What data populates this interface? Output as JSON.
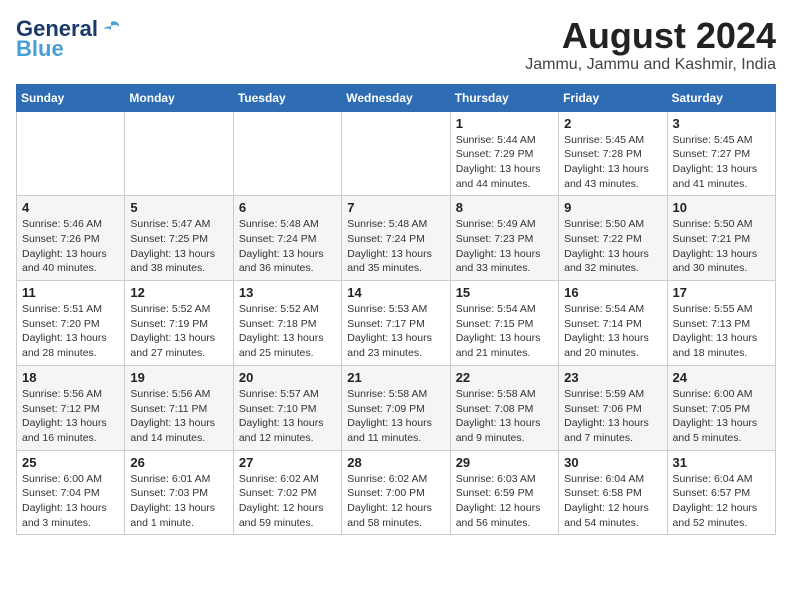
{
  "header": {
    "logo_line1": "General",
    "logo_line2": "Blue",
    "month_title": "August 2024",
    "location": "Jammu, Jammu and Kashmir, India"
  },
  "columns": [
    "Sunday",
    "Monday",
    "Tuesday",
    "Wednesday",
    "Thursday",
    "Friday",
    "Saturday"
  ],
  "weeks": [
    [
      {
        "day": "",
        "info": ""
      },
      {
        "day": "",
        "info": ""
      },
      {
        "day": "",
        "info": ""
      },
      {
        "day": "",
        "info": ""
      },
      {
        "day": "1",
        "info": "Sunrise: 5:44 AM\nSunset: 7:29 PM\nDaylight: 13 hours\nand 44 minutes."
      },
      {
        "day": "2",
        "info": "Sunrise: 5:45 AM\nSunset: 7:28 PM\nDaylight: 13 hours\nand 43 minutes."
      },
      {
        "day": "3",
        "info": "Sunrise: 5:45 AM\nSunset: 7:27 PM\nDaylight: 13 hours\nand 41 minutes."
      }
    ],
    [
      {
        "day": "4",
        "info": "Sunrise: 5:46 AM\nSunset: 7:26 PM\nDaylight: 13 hours\nand 40 minutes."
      },
      {
        "day": "5",
        "info": "Sunrise: 5:47 AM\nSunset: 7:25 PM\nDaylight: 13 hours\nand 38 minutes."
      },
      {
        "day": "6",
        "info": "Sunrise: 5:48 AM\nSunset: 7:24 PM\nDaylight: 13 hours\nand 36 minutes."
      },
      {
        "day": "7",
        "info": "Sunrise: 5:48 AM\nSunset: 7:24 PM\nDaylight: 13 hours\nand 35 minutes."
      },
      {
        "day": "8",
        "info": "Sunrise: 5:49 AM\nSunset: 7:23 PM\nDaylight: 13 hours\nand 33 minutes."
      },
      {
        "day": "9",
        "info": "Sunrise: 5:50 AM\nSunset: 7:22 PM\nDaylight: 13 hours\nand 32 minutes."
      },
      {
        "day": "10",
        "info": "Sunrise: 5:50 AM\nSunset: 7:21 PM\nDaylight: 13 hours\nand 30 minutes."
      }
    ],
    [
      {
        "day": "11",
        "info": "Sunrise: 5:51 AM\nSunset: 7:20 PM\nDaylight: 13 hours\nand 28 minutes."
      },
      {
        "day": "12",
        "info": "Sunrise: 5:52 AM\nSunset: 7:19 PM\nDaylight: 13 hours\nand 27 minutes."
      },
      {
        "day": "13",
        "info": "Sunrise: 5:52 AM\nSunset: 7:18 PM\nDaylight: 13 hours\nand 25 minutes."
      },
      {
        "day": "14",
        "info": "Sunrise: 5:53 AM\nSunset: 7:17 PM\nDaylight: 13 hours\nand 23 minutes."
      },
      {
        "day": "15",
        "info": "Sunrise: 5:54 AM\nSunset: 7:15 PM\nDaylight: 13 hours\nand 21 minutes."
      },
      {
        "day": "16",
        "info": "Sunrise: 5:54 AM\nSunset: 7:14 PM\nDaylight: 13 hours\nand 20 minutes."
      },
      {
        "day": "17",
        "info": "Sunrise: 5:55 AM\nSunset: 7:13 PM\nDaylight: 13 hours\nand 18 minutes."
      }
    ],
    [
      {
        "day": "18",
        "info": "Sunrise: 5:56 AM\nSunset: 7:12 PM\nDaylight: 13 hours\nand 16 minutes."
      },
      {
        "day": "19",
        "info": "Sunrise: 5:56 AM\nSunset: 7:11 PM\nDaylight: 13 hours\nand 14 minutes."
      },
      {
        "day": "20",
        "info": "Sunrise: 5:57 AM\nSunset: 7:10 PM\nDaylight: 13 hours\nand 12 minutes."
      },
      {
        "day": "21",
        "info": "Sunrise: 5:58 AM\nSunset: 7:09 PM\nDaylight: 13 hours\nand 11 minutes."
      },
      {
        "day": "22",
        "info": "Sunrise: 5:58 AM\nSunset: 7:08 PM\nDaylight: 13 hours\nand 9 minutes."
      },
      {
        "day": "23",
        "info": "Sunrise: 5:59 AM\nSunset: 7:06 PM\nDaylight: 13 hours\nand 7 minutes."
      },
      {
        "day": "24",
        "info": "Sunrise: 6:00 AM\nSunset: 7:05 PM\nDaylight: 13 hours\nand 5 minutes."
      }
    ],
    [
      {
        "day": "25",
        "info": "Sunrise: 6:00 AM\nSunset: 7:04 PM\nDaylight: 13 hours\nand 3 minutes."
      },
      {
        "day": "26",
        "info": "Sunrise: 6:01 AM\nSunset: 7:03 PM\nDaylight: 13 hours\nand 1 minute."
      },
      {
        "day": "27",
        "info": "Sunrise: 6:02 AM\nSunset: 7:02 PM\nDaylight: 12 hours\nand 59 minutes."
      },
      {
        "day": "28",
        "info": "Sunrise: 6:02 AM\nSunset: 7:00 PM\nDaylight: 12 hours\nand 58 minutes."
      },
      {
        "day": "29",
        "info": "Sunrise: 6:03 AM\nSunset: 6:59 PM\nDaylight: 12 hours\nand 56 minutes."
      },
      {
        "day": "30",
        "info": "Sunrise: 6:04 AM\nSunset: 6:58 PM\nDaylight: 12 hours\nand 54 minutes."
      },
      {
        "day": "31",
        "info": "Sunrise: 6:04 AM\nSunset: 6:57 PM\nDaylight: 12 hours\nand 52 minutes."
      }
    ]
  ]
}
